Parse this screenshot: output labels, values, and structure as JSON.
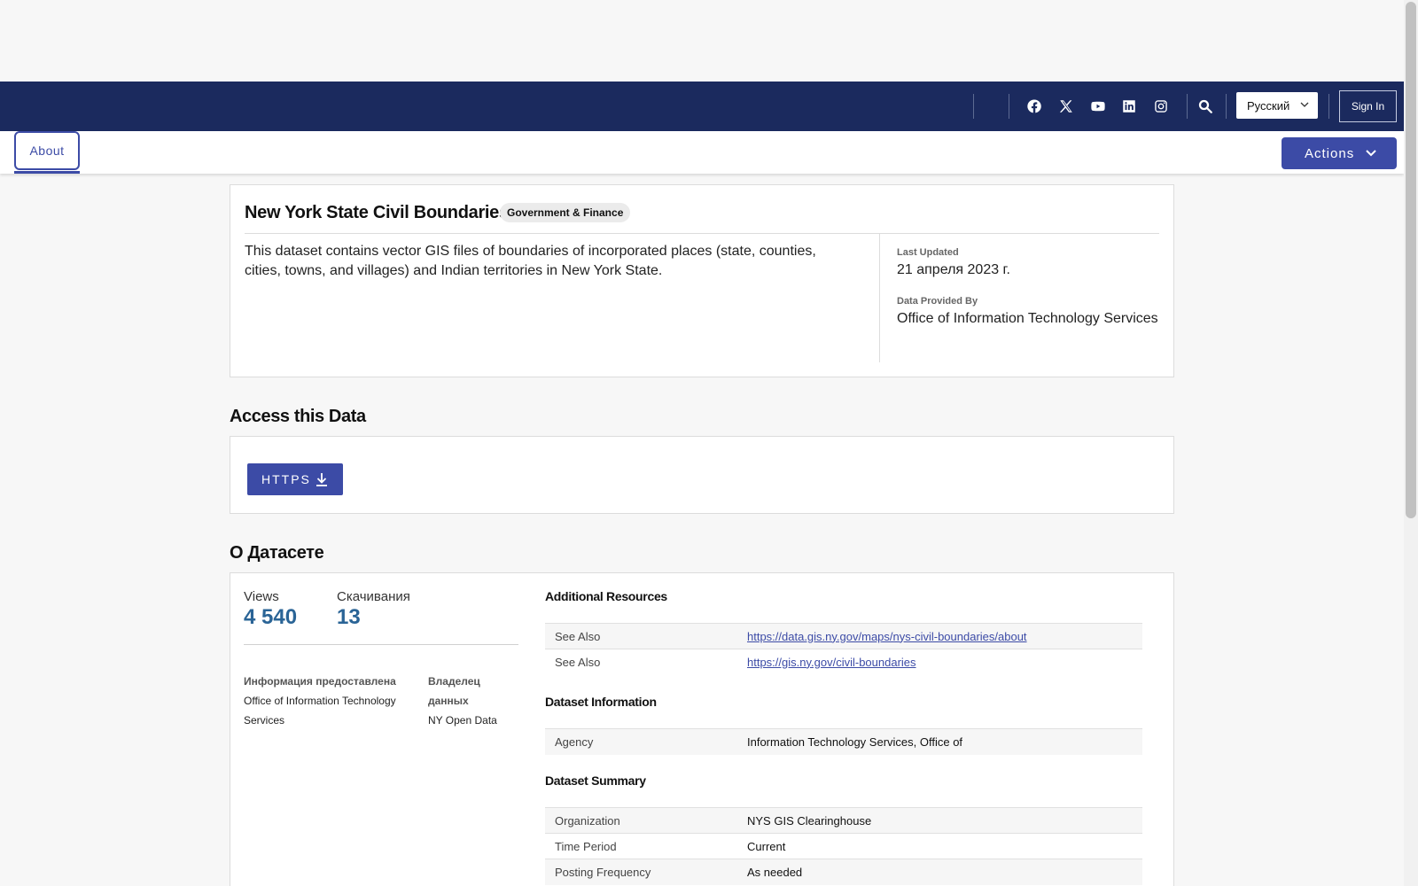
{
  "nav": {
    "social_icons": [
      "facebook-icon",
      "x-twitter-icon",
      "youtube-icon",
      "linkedin-icon",
      "instagram-icon"
    ],
    "search_icon": "search-icon",
    "language": "Русский",
    "sign_in": "Sign In"
  },
  "tabs": {
    "about": "About",
    "actions": "Actions"
  },
  "dataset": {
    "title": "New York State Civil Boundaries",
    "category": "Government & Finance",
    "description": "This dataset contains vector GIS files of boundaries of incorporated places (state, counties, cities, towns, and villages) and Indian territories in New York State.",
    "last_updated_label": "Last Updated",
    "last_updated_value": "21 апреля 2023 г.",
    "provided_by_label": "Data Provided By",
    "provided_by_value": "Office of Information Technology Services"
  },
  "access": {
    "heading": "Access this Data",
    "https_label": "HTTPS"
  },
  "about": {
    "heading": "О Датасете",
    "views_label": "Views",
    "views_value": "4 540",
    "downloads_label": "Скачивания",
    "downloads_value": "13",
    "provided_label": "Информация предоставлена",
    "provided_value": "Office of Information Technology Services",
    "owner_label": "Владелец данных",
    "owner_value": "NY Open Data",
    "additional_resources": {
      "heading": "Additional Resources",
      "rows": [
        {
          "key": "See Also",
          "value": "https://data.gis.ny.gov/maps/nys-civil-boundaries/about"
        },
        {
          "key": "See Also",
          "value": "https://gis.ny.gov/civil-boundaries"
        }
      ]
    },
    "dataset_information": {
      "heading": "Dataset Information",
      "rows": [
        {
          "key": "Agency",
          "value": "Information Technology Services, Office of"
        }
      ]
    },
    "dataset_summary": {
      "heading": "Dataset Summary",
      "rows": [
        {
          "key": "Organization",
          "value": "NYS GIS Clearinghouse"
        },
        {
          "key": "Time Period",
          "value": "Current"
        },
        {
          "key": "Posting Frequency",
          "value": "As needed"
        }
      ]
    }
  },
  "colors": {
    "navbar": "#1b2a5e",
    "accent": "#3c4ba6",
    "stat_value": "#2a6496"
  }
}
